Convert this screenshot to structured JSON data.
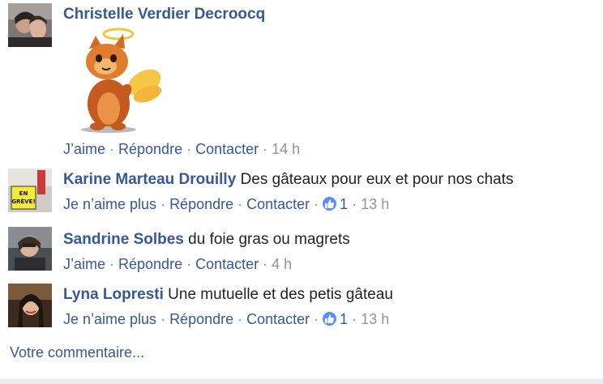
{
  "comments": [
    {
      "author": "Christelle Verdier Decroocq",
      "text": "",
      "sticker": "angel-cat-sticker",
      "actions": [
        "J’aime",
        "Répondre",
        "Contacter"
      ],
      "time": "14 h"
    },
    {
      "author": "Karine Marteau Drouilly",
      "text": "Des gâteaux pour eux et pour nos chats",
      "actions": [
        "Je n’aime plus",
        "Répondre",
        "Contacter"
      ],
      "likes": "1",
      "time": "13 h"
    },
    {
      "author": "Sandrine Solbes",
      "text": "du foie gras ou magrets",
      "actions": [
        "J’aime",
        "Répondre",
        "Contacter"
      ],
      "time": "4 h"
    },
    {
      "author": "Lyna Lopresti",
      "text": "Une mutuelle et des petis gâteau",
      "actions": [
        "Je n’aime plus",
        "Répondre",
        "Contacter"
      ],
      "likes": "1",
      "time": "13 h"
    }
  ],
  "composer": {
    "placeholder": "Votre commentaire..."
  },
  "colors": {
    "link": "#365899",
    "meta": "#90949c",
    "like_badge": "#5890ff"
  },
  "icons": {
    "like": "thumbs-up-icon"
  },
  "avatars": {
    "sign_text_1": "EN",
    "sign_text_2": "GRÈVE!"
  }
}
